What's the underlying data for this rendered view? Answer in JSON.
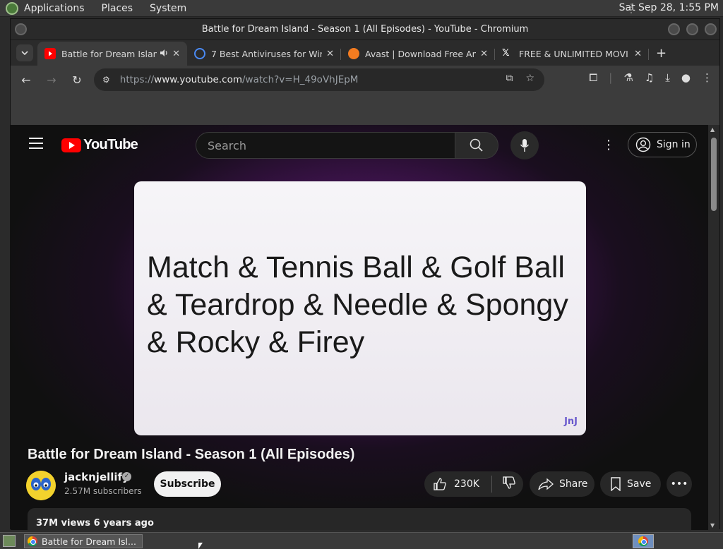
{
  "desktop": {
    "menus": [
      "Applications",
      "Places",
      "System"
    ],
    "clock": "Sat Sep 28,  1:55 PM"
  },
  "window": {
    "title": "Battle for Dream Island - Season 1 (All Episodes) - YouTube - Chromium"
  },
  "tabs": [
    {
      "title": "Battle for Dream Island",
      "favicon": "youtube-icon",
      "audio": true
    },
    {
      "title": "7 Best Antiviruses for Win",
      "favicon": "globe-icon"
    },
    {
      "title": "Avast | Download Free An",
      "favicon": "avast-icon"
    },
    {
      "title": "FREE & UNLIMITED MOVI",
      "favicon": "x-icon"
    }
  ],
  "omnibox": {
    "scheme": "https://",
    "host": "www.youtube.com",
    "path": "/watch?v=H_49oVhJEpM"
  },
  "youtube": {
    "logo_text": "YouTube",
    "search_placeholder": "Search",
    "sign_in": "Sign in",
    "video_caption": "Match & Tennis Ball & Golf Ball & Teardrop & Needle & Spongy & Rocky & Firey",
    "watermark": "JnJ",
    "video_title": "Battle for Dream Island - Season 1 (All Episodes)",
    "channel_name": "jacknjellify",
    "subscribers": "2.57M subscribers",
    "subscribe": "Subscribe",
    "likes": "230K",
    "share": "Share",
    "save": "Save",
    "description_stats": "37M views  6 years ago"
  },
  "taskbar": {
    "window_item": "Battle for Dream Isl..."
  }
}
